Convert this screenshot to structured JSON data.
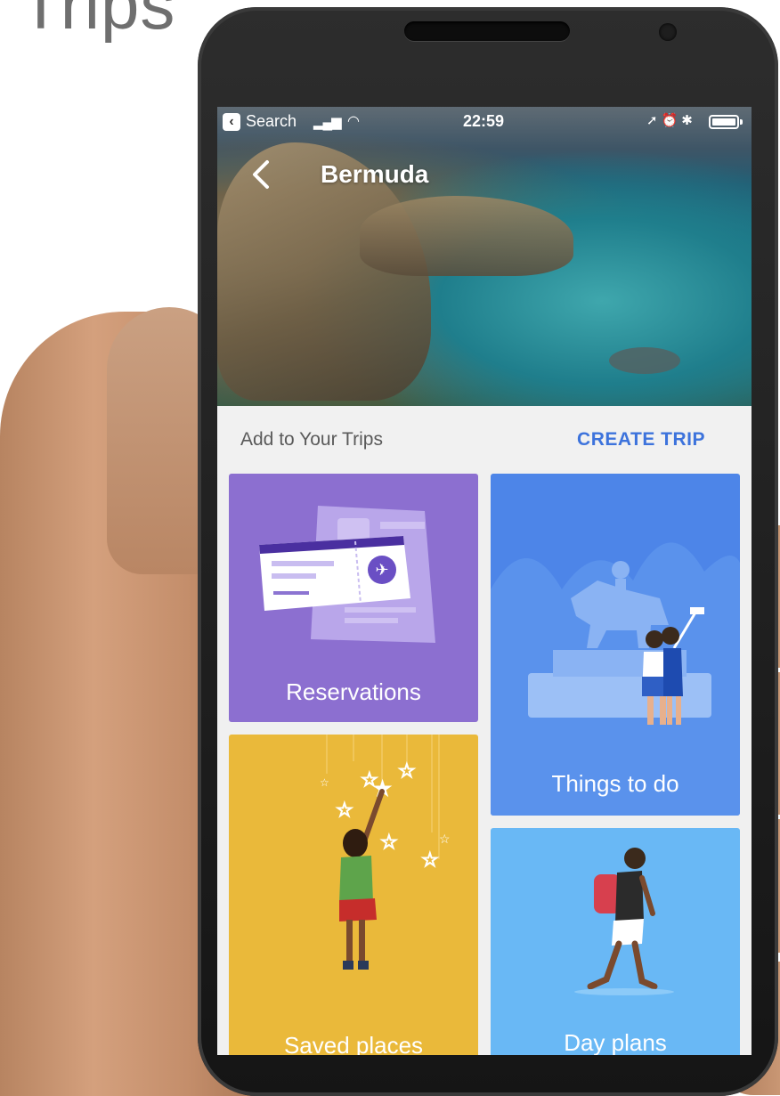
{
  "page": {
    "title": "Trips"
  },
  "status_bar": {
    "back_app_label": "Search",
    "signal": "••l",
    "wifi": "⌒",
    "time": "22:59",
    "icons": "↗⏰✳"
  },
  "header": {
    "title": "Bermuda"
  },
  "section": {
    "label": "Add to Your Trips",
    "action": "CREATE TRIP"
  },
  "cards": [
    {
      "label": "Reservations"
    },
    {
      "label": "Things to do"
    },
    {
      "label": "Saved places"
    },
    {
      "label": "Day plans"
    }
  ],
  "colors": {
    "reservations": "#8c6fd0",
    "things_to_do": "#4d85e8",
    "saved_places": "#eab93a",
    "day_plans": "#69b8f5",
    "accent": "#3d73dc"
  }
}
